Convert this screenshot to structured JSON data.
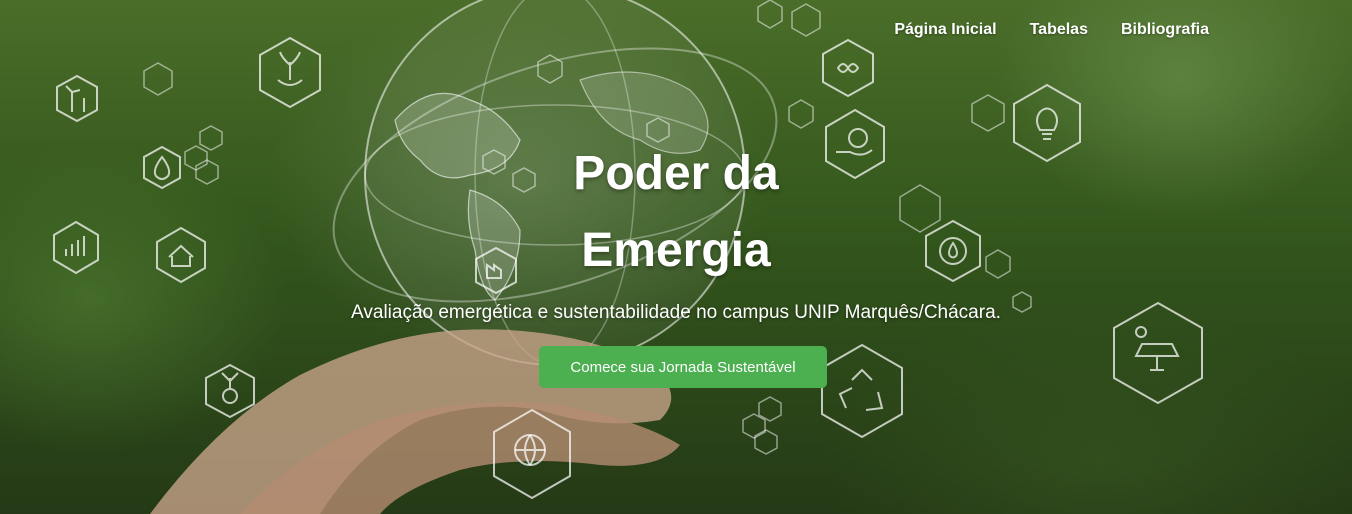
{
  "nav": {
    "items": [
      {
        "label": "Página Inicial"
      },
      {
        "label": "Tabelas"
      },
      {
        "label": "Bibliografia"
      }
    ]
  },
  "hero": {
    "title_line1": "Poder da",
    "title_line2": "Emergia",
    "subtitle": "Avaliação emergética e sustentabilidade no campus UNIP Marquês/Chácara.",
    "cta_label": "Comece sua Jornada Sustentável"
  },
  "colors": {
    "cta": "#4caf50",
    "background": "#4a7a2a",
    "text": "#ffffff"
  },
  "icons": [
    "globe-icon",
    "hands-icon",
    "wind-turbine-icon",
    "plant-hands-icon",
    "growth-chart-icon",
    "water-drop-icon",
    "eco-house-icon",
    "sprout-globe-icon",
    "globe-leaf-icon",
    "recycle-icon",
    "infinity-icon",
    "lightbulb-icon",
    "hand-globe-icon",
    "water-cycle-icon",
    "solar-panel-icon",
    "factory-icon"
  ]
}
